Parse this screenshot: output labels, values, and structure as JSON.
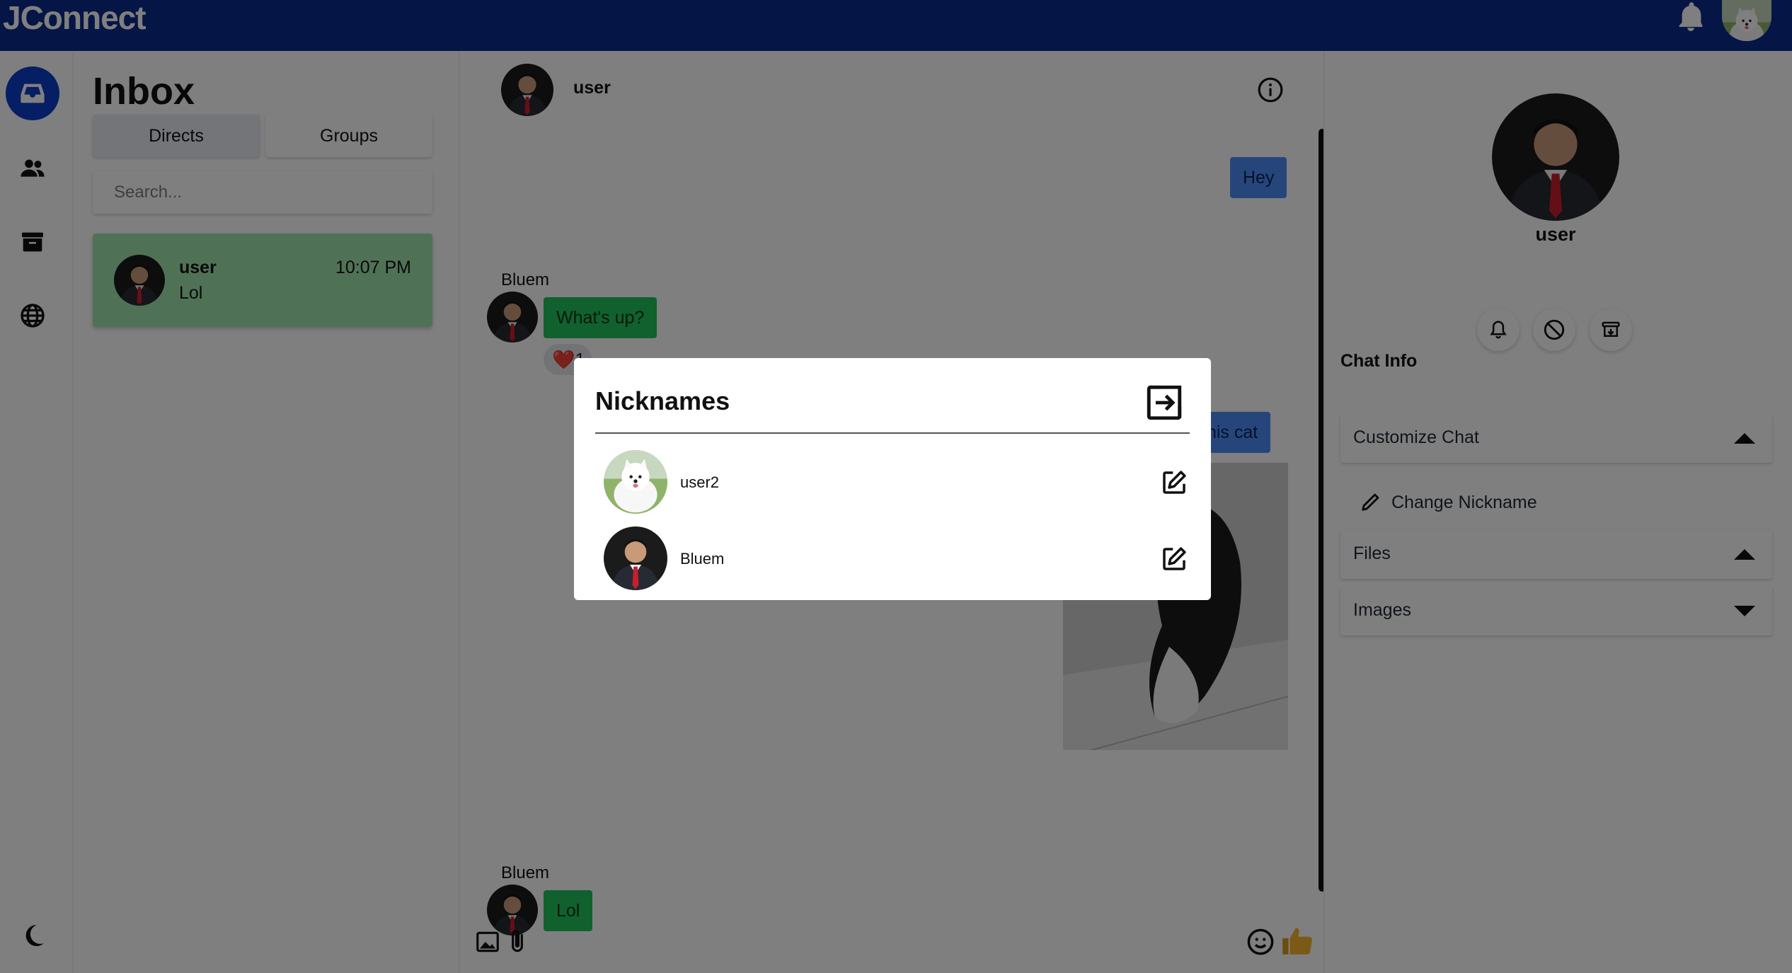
{
  "app": {
    "name": "JConnect"
  },
  "inbox": {
    "title": "Inbox",
    "tabs": [
      {
        "label": "Directs"
      },
      {
        "label": "Groups"
      }
    ],
    "search_placeholder": "Search...",
    "conversations": [
      {
        "name": "user",
        "time": "10:07 PM",
        "last_message": "Lol"
      }
    ]
  },
  "chat": {
    "header_name": "user",
    "messages": [
      {
        "direction": "out",
        "text": "Hey"
      },
      {
        "direction": "in",
        "sender": "Bluem",
        "text": "What's up?",
        "reaction": "❤️1"
      },
      {
        "direction": "out",
        "text": "this cat"
      },
      {
        "direction": "in",
        "sender": "Bluem",
        "text": "Lol"
      }
    ]
  },
  "profile": {
    "name": "user",
    "section_title": "Chat Info",
    "accordions": [
      {
        "label": "Customize Chat",
        "state": "expanded"
      },
      {
        "label": "Files",
        "state": "expanded"
      },
      {
        "label": "Images",
        "state": "collapsed"
      }
    ],
    "customize_items": [
      {
        "label": "Change Nickname",
        "icon": "pencil-icon"
      }
    ]
  },
  "modal": {
    "title": "Nicknames",
    "members": [
      {
        "name": "user2",
        "avatar": "white-dog"
      },
      {
        "name": "Bluem",
        "avatar": "man-in-suit"
      }
    ]
  },
  "colors": {
    "topbar": "#0b2a8c",
    "rail_active": "#0b3cc8",
    "conversation_active": "#9fe5ad",
    "outgoing_bubble": "#4c8df6",
    "incoming_bubble": "#21c25c"
  }
}
